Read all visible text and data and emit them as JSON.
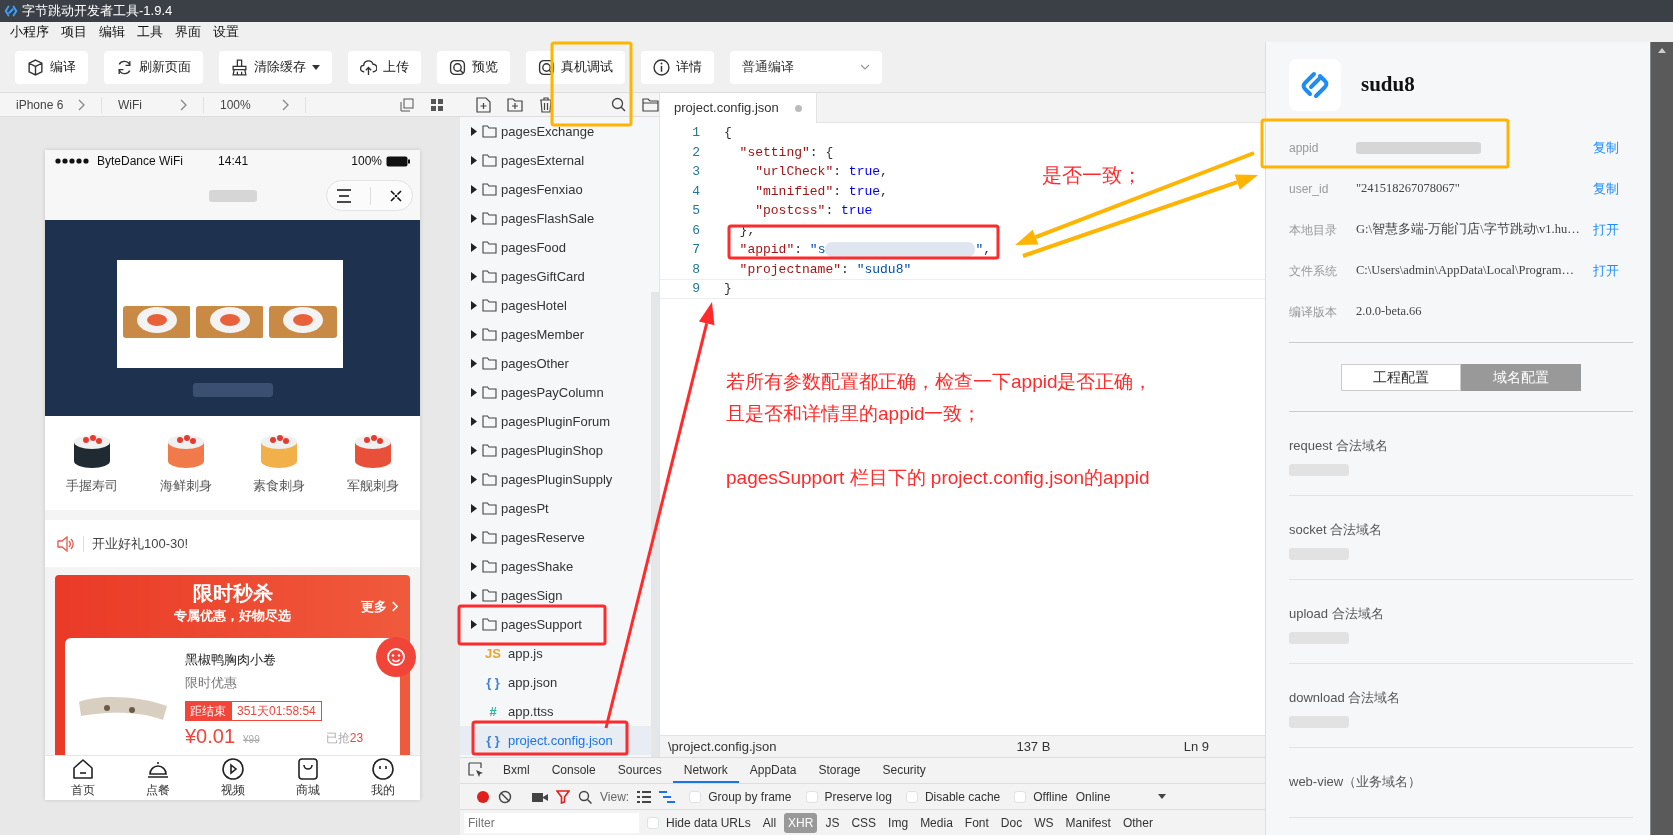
{
  "window": {
    "title": "字节跳动开发者工具-1.9.4"
  },
  "menu": [
    "小程序",
    "项目",
    "编辑",
    "工具",
    "界面",
    "设置"
  ],
  "toolbar": {
    "buttons": [
      {
        "kind": "compile",
        "label": "编译",
        "dropdown": false
      },
      {
        "kind": "refresh",
        "label": "刷新页面",
        "dropdown": false
      },
      {
        "kind": "clear",
        "label": "清除缓存",
        "dropdown": true
      },
      {
        "kind": "upload",
        "label": "上传",
        "dropdown": false
      },
      {
        "kind": "preview",
        "label": "预览",
        "dropdown": false
      },
      {
        "kind": "debug",
        "label": "真机调试",
        "dropdown": false
      },
      {
        "kind": "info",
        "label": "详情",
        "dropdown": false
      }
    ],
    "compile_mode": "普通编译"
  },
  "device_bar": {
    "device": "iPhone 6",
    "network": "WiFi",
    "zoom": "100%"
  },
  "phone": {
    "status": {
      "carrier": "ByteDance WiFi",
      "time": "14:41",
      "battery": "100%"
    },
    "categories": [
      {
        "label": "手握寿司",
        "color": "#1f2a33"
      },
      {
        "label": "海鲜刺身",
        "color": "#f07a4a"
      },
      {
        "label": "素食刺身",
        "color": "#f2b04a"
      },
      {
        "label": "军舰刺身",
        "color": "#e8503a"
      }
    ],
    "notice": "开业好礼100-30!",
    "flash_sale": {
      "title": "限时秒杀",
      "subtitle": "专属优惠，好物尽选",
      "more": "更多",
      "product": {
        "name": "黑椒鸭胸肉小卷",
        "tag": "限时优惠",
        "countdown_label": "距结束",
        "countdown": "351天01:58:54",
        "price": "¥0.01",
        "original_price": "¥99",
        "sold_label": "已抢",
        "sold_count": "23"
      }
    },
    "tabbar": [
      {
        "kind": "home",
        "label": "首页"
      },
      {
        "kind": "bell",
        "label": "点餐"
      },
      {
        "kind": "play",
        "label": "视频"
      },
      {
        "kind": "bag",
        "label": "商城"
      },
      {
        "kind": "face",
        "label": "我的"
      }
    ]
  },
  "file_tree": {
    "items": [
      {
        "kind": "folder",
        "name": "pagesExchange",
        "expanded": false,
        "selected": false
      },
      {
        "kind": "folder",
        "name": "pagesExternal",
        "expanded": false,
        "selected": false
      },
      {
        "kind": "folder",
        "name": "pagesFenxiao",
        "expanded": false,
        "selected": false
      },
      {
        "kind": "folder",
        "name": "pagesFlashSale",
        "expanded": false,
        "selected": false
      },
      {
        "kind": "folder",
        "name": "pagesFood",
        "expanded": false,
        "selected": false
      },
      {
        "kind": "folder",
        "name": "pagesGiftCard",
        "expanded": false,
        "selected": false
      },
      {
        "kind": "folder",
        "name": "pagesHotel",
        "expanded": false,
        "selected": false
      },
      {
        "kind": "folder",
        "name": "pagesMember",
        "expanded": false,
        "selected": false
      },
      {
        "kind": "folder",
        "name": "pagesOther",
        "expanded": false,
        "selected": false
      },
      {
        "kind": "folder",
        "name": "pagesPayColumn",
        "expanded": false,
        "selected": false
      },
      {
        "kind": "folder",
        "name": "pagesPluginForum",
        "expanded": false,
        "selected": false
      },
      {
        "kind": "folder",
        "name": "pagesPluginShop",
        "expanded": false,
        "selected": false
      },
      {
        "kind": "folder",
        "name": "pagesPluginSupply",
        "expanded": false,
        "selected": false
      },
      {
        "kind": "folder",
        "name": "pagesPt",
        "expanded": false,
        "selected": false
      },
      {
        "kind": "folder",
        "name": "pagesReserve",
        "expanded": false,
        "selected": false
      },
      {
        "kind": "folder",
        "name": "pagesShake",
        "expanded": false,
        "selected": false
      },
      {
        "kind": "folder",
        "name": "pagesSign",
        "expanded": false,
        "selected": false
      },
      {
        "kind": "folder",
        "name": "pagesSupport",
        "expanded": false,
        "selected": false
      },
      {
        "kind": "file",
        "icon_text": "JS",
        "color": "#e8a530",
        "name": "app.js",
        "selected": false
      },
      {
        "kind": "file",
        "icon_text": "{ }",
        "color": "#3d7fd6",
        "name": "app.json",
        "selected": false
      },
      {
        "kind": "file",
        "icon_text": "#",
        "color": "#2bb59a",
        "name": "app.ttss",
        "selected": false
      },
      {
        "kind": "file",
        "icon_text": "{ }",
        "color": "#3d7fd6",
        "name": "project.config.json",
        "selected": true
      }
    ]
  },
  "editor": {
    "tabs": [
      {
        "label": "project.config.json",
        "modified": true,
        "selected": true
      }
    ],
    "lines": [
      {
        "n": "1",
        "current": false,
        "tokens": [
          {
            "kind": "punct",
            "text": "{"
          }
        ]
      },
      {
        "n": "2",
        "current": false,
        "tokens": [
          {
            "kind": "key",
            "text": "  \"setting\""
          },
          {
            "kind": "punct",
            "text": ": {"
          }
        ]
      },
      {
        "n": "3",
        "current": false,
        "tokens": [
          {
            "kind": "key",
            "text": "    \"urlCheck\""
          },
          {
            "kind": "punct",
            "text": ": "
          },
          {
            "kind": "bool",
            "text": "true"
          },
          {
            "kind": "punct",
            "text": ","
          }
        ]
      },
      {
        "n": "4",
        "current": false,
        "tokens": [
          {
            "kind": "key",
            "text": "    \"minified\""
          },
          {
            "kind": "punct",
            "text": ": "
          },
          {
            "kind": "bool",
            "text": "true"
          },
          {
            "kind": "punct",
            "text": ","
          }
        ]
      },
      {
        "n": "5",
        "current": false,
        "tokens": [
          {
            "kind": "key",
            "text": "    \"postcss\""
          },
          {
            "kind": "punct",
            "text": ": "
          },
          {
            "kind": "bool",
            "text": "true"
          }
        ]
      },
      {
        "n": "6",
        "current": false,
        "tokens": [
          {
            "kind": "punct",
            "text": "  },"
          }
        ]
      },
      {
        "n": "7",
        "current": false,
        "tokens": [
          {
            "kind": "key",
            "text": "  \"appid\""
          },
          {
            "kind": "punct",
            "text": ": "
          },
          {
            "kind": "str",
            "text": "\"s"
          },
          {
            "kind": "blur"
          },
          {
            "kind": "str",
            "text": "\""
          },
          {
            "kind": "punct",
            "text": ","
          }
        ]
      },
      {
        "n": "8",
        "current": false,
        "tokens": [
          {
            "kind": "key",
            "text": "  \"projectname\""
          },
          {
            "kind": "punct",
            "text": ": "
          },
          {
            "kind": "str",
            "text": "\"sudu8\""
          }
        ]
      },
      {
        "n": "9",
        "current": true,
        "tokens": [
          {
            "kind": "punct",
            "text": "}"
          }
        ]
      }
    ],
    "status": {
      "path": "\\project.config.json",
      "size": "137 B",
      "position": "Ln 9"
    }
  },
  "devtools": {
    "tabs": [
      {
        "label": "Bxml",
        "selected": false
      },
      {
        "label": "Console",
        "selected": false
      },
      {
        "label": "Sources",
        "selected": false
      },
      {
        "label": "Network",
        "selected": true
      },
      {
        "label": "AppData",
        "selected": false
      },
      {
        "label": "Storage",
        "selected": false
      },
      {
        "label": "Security",
        "selected": false
      }
    ],
    "recording": true,
    "view_label": "View:",
    "options": [
      {
        "label": "Group by frame",
        "checked": false
      },
      {
        "label": "Preserve log",
        "checked": false
      },
      {
        "label": "Disable cache",
        "checked": false
      },
      {
        "label": "Offline",
        "checked": false
      }
    ],
    "throttle": "Online",
    "filter": {
      "placeholder": "Filter"
    },
    "hide_data_urls": {
      "label": "Hide data URLs",
      "checked": false
    },
    "types": [
      {
        "label": "All",
        "selected": false
      },
      {
        "label": "XHR",
        "selected": true
      },
      {
        "label": "JS",
        "selected": false
      },
      {
        "label": "CSS",
        "selected": false
      },
      {
        "label": "Img",
        "selected": false
      },
      {
        "label": "Media",
        "selected": false
      },
      {
        "label": "Font",
        "selected": false
      },
      {
        "label": "Doc",
        "selected": false
      },
      {
        "label": "WS",
        "selected": false
      },
      {
        "label": "Manifest",
        "selected": false
      },
      {
        "label": "Other",
        "selected": false
      }
    ]
  },
  "details": {
    "name": "sudu8",
    "rows": [
      {
        "kind": "blurred",
        "label": "appid",
        "action": "复制"
      },
      {
        "kind": "text",
        "label": "user_id",
        "value": "\"241518267078067\"",
        "action": "复制"
      },
      {
        "kind": "text",
        "label": "本地目录",
        "value": "G:\\智慧多端-万能门店\\字节跳动\\v1.hu…",
        "action": "打开"
      },
      {
        "kind": "text",
        "label": "文件系统",
        "value": "C:\\Users\\admin\\AppData\\Local\\Program…",
        "action": "打开"
      },
      {
        "kind": "text",
        "label": "编译版本",
        "value": "2.0.0-beta.66"
      }
    ],
    "segments": [
      {
        "label": "工程配置",
        "selected": false
      },
      {
        "label": "域名配置",
        "selected": true
      }
    ],
    "domains": [
      {
        "label": "request 合法域名",
        "blurred": true
      },
      {
        "label": "socket 合法域名",
        "blurred": true
      },
      {
        "label": "upload 合法域名",
        "blurred": true
      },
      {
        "label": "download 合法域名",
        "blurred": true
      },
      {
        "label": "web-view（业务域名）",
        "blurred": false
      }
    ]
  },
  "annotations": {
    "boxes": [
      {
        "color": "#ffb400"
      },
      {
        "color": "#ffb400"
      },
      {
        "color": "#ff2a2a"
      },
      {
        "color": "#ff2a2a"
      },
      {
        "color": "#ff2a2a"
      }
    ],
    "arrows": [
      {
        "color": "#ff2a2a"
      },
      {
        "color": "#ffb400"
      },
      {
        "color": "#ffb400"
      }
    ],
    "notes": [
      {
        "text": "是否一致；"
      },
      {
        "text": "若所有参数配置都正确，检查一下appid是否正确，"
      },
      {
        "text": "且是否和详情里的appid一致；"
      },
      {
        "text": "pagesSupport 栏目下的 project.config.json的appid"
      }
    ]
  }
}
